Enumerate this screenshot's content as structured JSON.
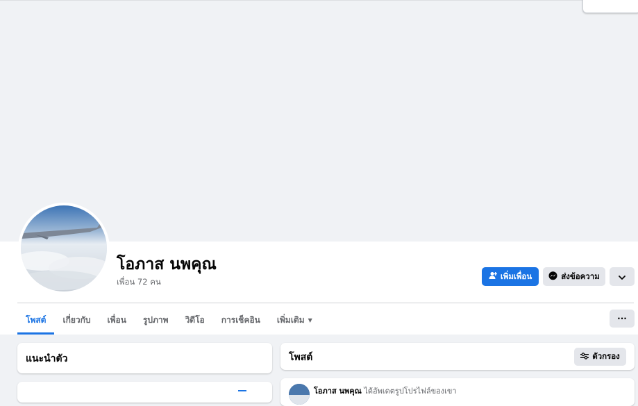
{
  "profile": {
    "name": "โอภาส นพคุณ",
    "friends_count": "เพื่อน 72 คน"
  },
  "actions": {
    "add_friend": "เพิ่มเพื่อน",
    "message": "ส่งข้อความ",
    "more_icon": "chevron-down-icon"
  },
  "tabs": [
    {
      "label": "โพสต์",
      "active": true
    },
    {
      "label": "เกี่ยวกับ"
    },
    {
      "label": "เพื่อน"
    },
    {
      "label": "รูปภาพ"
    },
    {
      "label": "วิดีโอ"
    },
    {
      "label": "การเช็คอิน"
    },
    {
      "label": "เพิ่มเติม"
    }
  ],
  "tab_menu": "···",
  "intro": {
    "title": "แนะนำตัว"
  },
  "posts": {
    "title": "โพสต์",
    "filter_label": "ตัวกรอง",
    "first_post": {
      "author": "โอภาส นพคุณ",
      "action": "ได้อัพเดตรูปโปรไฟล์ของเขา"
    }
  },
  "colors": {
    "accent": "#1b74e4",
    "background": "#f0f2f5",
    "button_gray": "#e4e6eb"
  }
}
